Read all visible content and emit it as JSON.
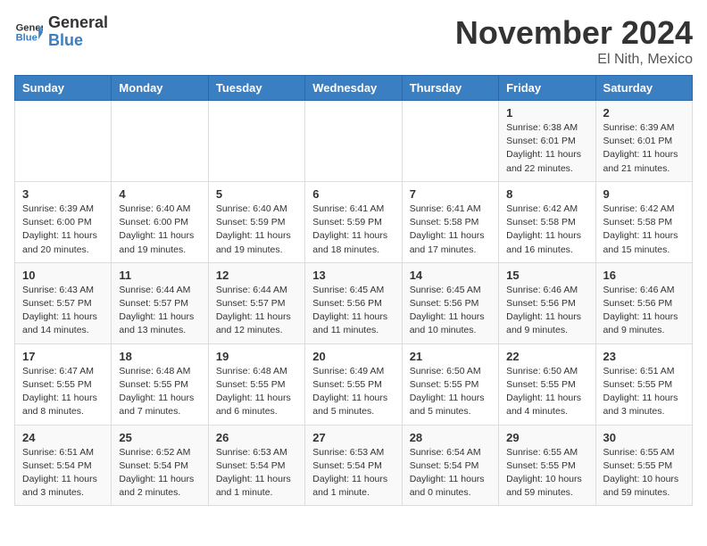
{
  "header": {
    "logo_general": "General",
    "logo_blue": "Blue",
    "month": "November 2024",
    "location": "El Nith, Mexico"
  },
  "days_of_week": [
    "Sunday",
    "Monday",
    "Tuesday",
    "Wednesday",
    "Thursday",
    "Friday",
    "Saturday"
  ],
  "weeks": [
    [
      {
        "day": "",
        "info": ""
      },
      {
        "day": "",
        "info": ""
      },
      {
        "day": "",
        "info": ""
      },
      {
        "day": "",
        "info": ""
      },
      {
        "day": "",
        "info": ""
      },
      {
        "day": "1",
        "info": "Sunrise: 6:38 AM\nSunset: 6:01 PM\nDaylight: 11 hours and 22 minutes."
      },
      {
        "day": "2",
        "info": "Sunrise: 6:39 AM\nSunset: 6:01 PM\nDaylight: 11 hours and 21 minutes."
      }
    ],
    [
      {
        "day": "3",
        "info": "Sunrise: 6:39 AM\nSunset: 6:00 PM\nDaylight: 11 hours and 20 minutes."
      },
      {
        "day": "4",
        "info": "Sunrise: 6:40 AM\nSunset: 6:00 PM\nDaylight: 11 hours and 19 minutes."
      },
      {
        "day": "5",
        "info": "Sunrise: 6:40 AM\nSunset: 5:59 PM\nDaylight: 11 hours and 19 minutes."
      },
      {
        "day": "6",
        "info": "Sunrise: 6:41 AM\nSunset: 5:59 PM\nDaylight: 11 hours and 18 minutes."
      },
      {
        "day": "7",
        "info": "Sunrise: 6:41 AM\nSunset: 5:58 PM\nDaylight: 11 hours and 17 minutes."
      },
      {
        "day": "8",
        "info": "Sunrise: 6:42 AM\nSunset: 5:58 PM\nDaylight: 11 hours and 16 minutes."
      },
      {
        "day": "9",
        "info": "Sunrise: 6:42 AM\nSunset: 5:58 PM\nDaylight: 11 hours and 15 minutes."
      }
    ],
    [
      {
        "day": "10",
        "info": "Sunrise: 6:43 AM\nSunset: 5:57 PM\nDaylight: 11 hours and 14 minutes."
      },
      {
        "day": "11",
        "info": "Sunrise: 6:44 AM\nSunset: 5:57 PM\nDaylight: 11 hours and 13 minutes."
      },
      {
        "day": "12",
        "info": "Sunrise: 6:44 AM\nSunset: 5:57 PM\nDaylight: 11 hours and 12 minutes."
      },
      {
        "day": "13",
        "info": "Sunrise: 6:45 AM\nSunset: 5:56 PM\nDaylight: 11 hours and 11 minutes."
      },
      {
        "day": "14",
        "info": "Sunrise: 6:45 AM\nSunset: 5:56 PM\nDaylight: 11 hours and 10 minutes."
      },
      {
        "day": "15",
        "info": "Sunrise: 6:46 AM\nSunset: 5:56 PM\nDaylight: 11 hours and 9 minutes."
      },
      {
        "day": "16",
        "info": "Sunrise: 6:46 AM\nSunset: 5:56 PM\nDaylight: 11 hours and 9 minutes."
      }
    ],
    [
      {
        "day": "17",
        "info": "Sunrise: 6:47 AM\nSunset: 5:55 PM\nDaylight: 11 hours and 8 minutes."
      },
      {
        "day": "18",
        "info": "Sunrise: 6:48 AM\nSunset: 5:55 PM\nDaylight: 11 hours and 7 minutes."
      },
      {
        "day": "19",
        "info": "Sunrise: 6:48 AM\nSunset: 5:55 PM\nDaylight: 11 hours and 6 minutes."
      },
      {
        "day": "20",
        "info": "Sunrise: 6:49 AM\nSunset: 5:55 PM\nDaylight: 11 hours and 5 minutes."
      },
      {
        "day": "21",
        "info": "Sunrise: 6:50 AM\nSunset: 5:55 PM\nDaylight: 11 hours and 5 minutes."
      },
      {
        "day": "22",
        "info": "Sunrise: 6:50 AM\nSunset: 5:55 PM\nDaylight: 11 hours and 4 minutes."
      },
      {
        "day": "23",
        "info": "Sunrise: 6:51 AM\nSunset: 5:55 PM\nDaylight: 11 hours and 3 minutes."
      }
    ],
    [
      {
        "day": "24",
        "info": "Sunrise: 6:51 AM\nSunset: 5:54 PM\nDaylight: 11 hours and 3 minutes."
      },
      {
        "day": "25",
        "info": "Sunrise: 6:52 AM\nSunset: 5:54 PM\nDaylight: 11 hours and 2 minutes."
      },
      {
        "day": "26",
        "info": "Sunrise: 6:53 AM\nSunset: 5:54 PM\nDaylight: 11 hours and 1 minute."
      },
      {
        "day": "27",
        "info": "Sunrise: 6:53 AM\nSunset: 5:54 PM\nDaylight: 11 hours and 1 minute."
      },
      {
        "day": "28",
        "info": "Sunrise: 6:54 AM\nSunset: 5:54 PM\nDaylight: 11 hours and 0 minutes."
      },
      {
        "day": "29",
        "info": "Sunrise: 6:55 AM\nSunset: 5:55 PM\nDaylight: 10 hours and 59 minutes."
      },
      {
        "day": "30",
        "info": "Sunrise: 6:55 AM\nSunset: 5:55 PM\nDaylight: 10 hours and 59 minutes."
      }
    ]
  ]
}
